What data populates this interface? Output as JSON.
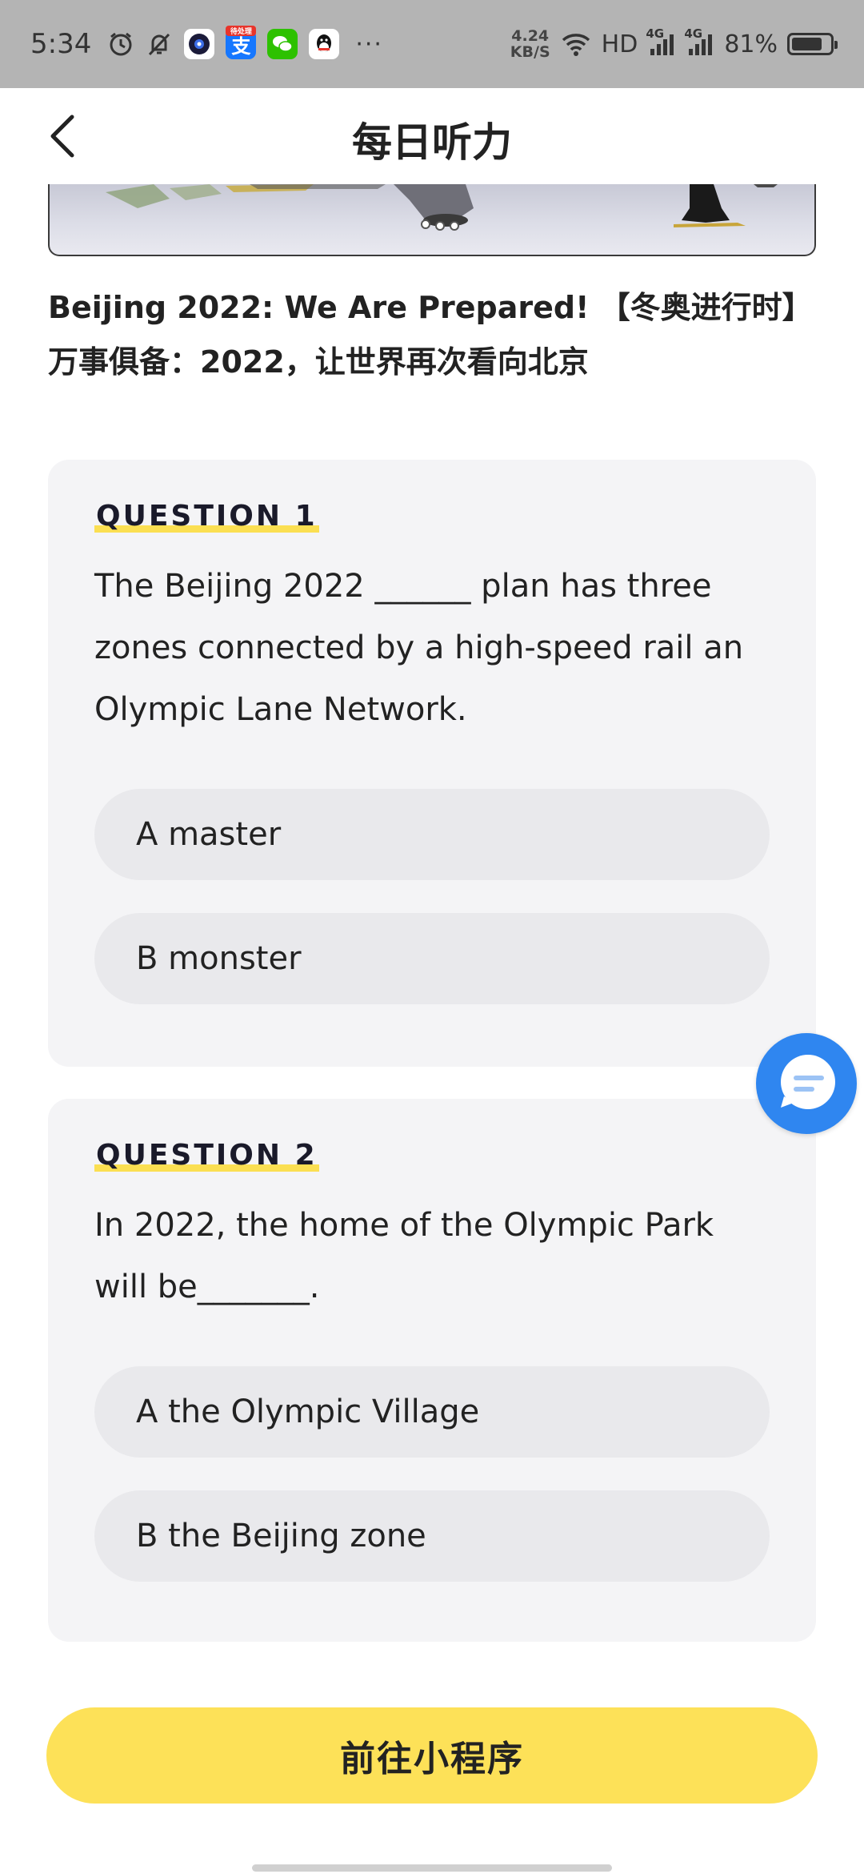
{
  "status_bar": {
    "time": "5:34",
    "net_speed_value": "4.24",
    "net_speed_unit": "KB/S",
    "hd_label": "HD",
    "net_tag_1": "4G",
    "net_tag_2": "4G",
    "battery_percent": "81%",
    "battery_level": 0.81,
    "app_icon_alipay_label": "支",
    "app_icon_alipay_badge": "待处理",
    "more_label": "···",
    "icons": [
      "alarm-icon",
      "bell-off-icon",
      "camera-app-icon",
      "alipay-icon",
      "wechat-icon",
      "qq-icon",
      "wifi-icon",
      "signal-icon",
      "battery-icon"
    ]
  },
  "header": {
    "title": "每日听力",
    "back_icon": "chevron-left-icon"
  },
  "article": {
    "title": "Beijing 2022: We Are Prepared! 【冬奥进行时】万事俱备：2022，让世界再次看向北京"
  },
  "questions": [
    {
      "label": "QUESTION 1",
      "text": "The Beijing 2022 ______ plan has three zones connected by a high-speed rail an Olympic Lane Network.",
      "options": [
        "A master",
        "B monster"
      ]
    },
    {
      "label": "QUESTION 2",
      "text": "In 2022, the home of the Olympic Park will be_______.",
      "options": [
        "A the Olympic Village",
        "B the Beijing zone"
      ]
    }
  ],
  "cta": {
    "label": "前往小程序"
  },
  "colors": {
    "accent_yellow": "#fde158",
    "chat_blue": "#2f86f0",
    "card_bg": "#f4f4f6",
    "option_bg": "#e9e9ec"
  }
}
